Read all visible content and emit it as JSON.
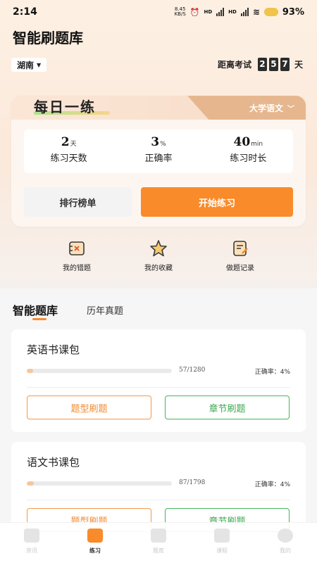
{
  "status_bar": {
    "time": "2:14",
    "net_speed": "8.45",
    "net_unit": "KB/S",
    "carrier1": "HD",
    "carrier2": "HD",
    "battery": "93%"
  },
  "header": {
    "title": "智能刷题库",
    "region": "湖南",
    "countdown_prefix": "距离考试",
    "countdown_digits": [
      "2",
      "5",
      "7"
    ],
    "countdown_suffix": "天"
  },
  "daily": {
    "title": "每日一练",
    "subject": "大学语文",
    "stats": [
      {
        "value": "2",
        "unit": "天",
        "label": "练习天数"
      },
      {
        "value": "3",
        "unit": "%",
        "label": "正确率"
      },
      {
        "value": "40",
        "unit": "min",
        "label": "练习时长"
      }
    ],
    "rank_button": "排行榜单",
    "start_button": "开始练习"
  },
  "quick_links": [
    {
      "label": "我的错题",
      "icon": "wrong-questions-icon"
    },
    {
      "label": "我的收藏",
      "icon": "star-icon"
    },
    {
      "label": "做题记录",
      "icon": "record-icon"
    }
  ],
  "tabs": {
    "active": "智能题库",
    "other": "历年真题"
  },
  "packs": [
    {
      "name": "英语书课包",
      "progress": "57/1280",
      "progress_ratio": 0.045,
      "accuracy": "正确率：4%",
      "type_button": "题型刷题",
      "chapter_button": "章节刷题"
    },
    {
      "name": "语文书课包",
      "progress": "87/1798",
      "progress_ratio": 0.048,
      "accuracy": "正确率：4%",
      "type_button": "题型刷题",
      "chapter_button": "章节刷题"
    }
  ],
  "bottom_nav": [
    {
      "label": "资讯",
      "icon": "news-icon",
      "active": false
    },
    {
      "label": "练习",
      "icon": "practice-icon",
      "active": true
    },
    {
      "label": "题库",
      "icon": "book-icon",
      "active": false
    },
    {
      "label": "课程",
      "icon": "video-icon",
      "active": false
    },
    {
      "label": "我的",
      "icon": "profile-icon",
      "active": false
    }
  ],
  "colors": {
    "accent": "#f98b2b",
    "green": "#3aa84d",
    "tab_bg": "#e6b78e"
  }
}
